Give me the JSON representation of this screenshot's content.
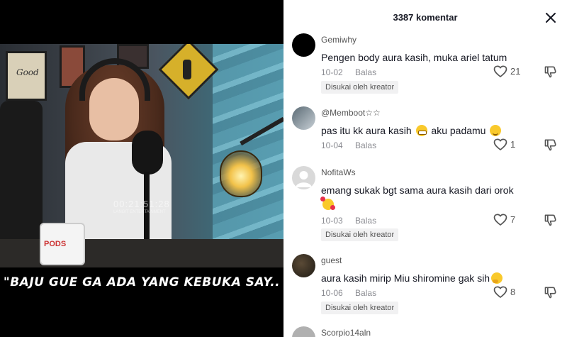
{
  "video": {
    "poster_text": "Good",
    "mug_logo": "PODS",
    "watermark_time": "00:21:51:28",
    "watermark_sub": "LANGIT ENTERTAINMENT",
    "caption": "\"BAJU GUE GA ADA YANG KEBUKA SAY.."
  },
  "comments_panel": {
    "title": "3387 komentar",
    "close_icon": "close-icon",
    "comments": [
      {
        "username": "Gemiwhy",
        "avatar_color": "#000000",
        "text": "Pengen body aura kasih, muka ariel tatum",
        "date": "10-02",
        "reply_label": "Balas",
        "likes": "21",
        "badge": "Disukai oleh kreator"
      },
      {
        "username": "@Memboot☆☆",
        "avatar_color": "#8a9aa6",
        "text_before": "pas itu kk aura kasih",
        "emoji1": "grinning-face",
        "text_middle": "aku padamu",
        "emoji2": "winking-face",
        "date": "10-04",
        "reply_label": "Balas",
        "likes": "1"
      },
      {
        "username": "NofitaWs",
        "avatar_color": "#d9d9d9",
        "text": "emang sukak bgt sama aura kasih dari orok",
        "emoji": "smiling-face-with-hearts",
        "date": "10-03",
        "reply_label": "Balas",
        "likes": "7",
        "badge": "Disukai oleh kreator"
      },
      {
        "username": "guest",
        "avatar_color": "#2f2a22",
        "text": "aura kasih mirip Miu shiromine gak sih",
        "emoji": "thinking-face",
        "date": "10-06",
        "reply_label": "Balas",
        "likes": "8",
        "badge": "Disukai oleh kreator"
      },
      {
        "username": "Scorpio14aln",
        "avatar_color": "#b0b0b0"
      }
    ]
  }
}
